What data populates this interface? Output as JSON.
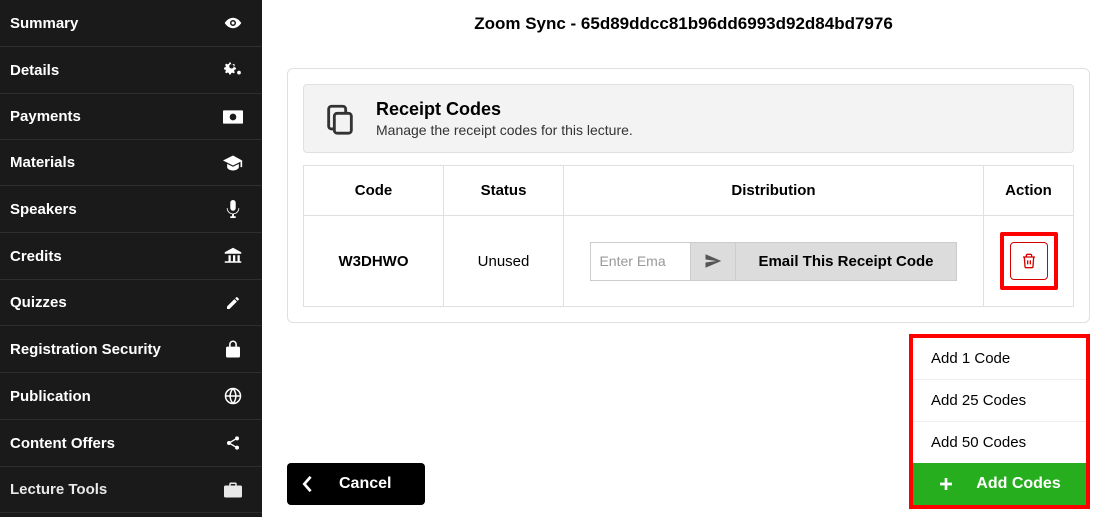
{
  "sidebar": {
    "items": [
      {
        "label": "Summary",
        "icon": "eye"
      },
      {
        "label": "Details",
        "icon": "cogs"
      },
      {
        "label": "Payments",
        "icon": "money"
      },
      {
        "label": "Materials",
        "icon": "graduation"
      },
      {
        "label": "Speakers",
        "icon": "mic"
      },
      {
        "label": "Credits",
        "icon": "bank"
      },
      {
        "label": "Quizzes",
        "icon": "pencil"
      },
      {
        "label": "Registration Security",
        "icon": "lock"
      },
      {
        "label": "Publication",
        "icon": "globe"
      },
      {
        "label": "Content Offers",
        "icon": "share"
      },
      {
        "label": "Lecture Tools",
        "icon": "briefcase"
      }
    ]
  },
  "page_title": "Zoom Sync - 65d89ddcc81b96dd6993d92d84bd7976",
  "section": {
    "title": "Receipt Codes",
    "subtitle": "Manage the receipt codes for this lecture."
  },
  "table": {
    "headers": {
      "code": "Code",
      "status": "Status",
      "distribution": "Distribution",
      "action": "Action"
    },
    "rows": [
      {
        "code": "W3DHWO",
        "status": "Unused"
      }
    ],
    "email_placeholder": "Enter Ema",
    "email_button": "Email This Receipt Code"
  },
  "cancel_label": "Cancel",
  "menu": {
    "items": [
      "Add 1 Code",
      "Add 25 Codes",
      "Add 50 Codes"
    ],
    "button_label": "Add Codes"
  }
}
